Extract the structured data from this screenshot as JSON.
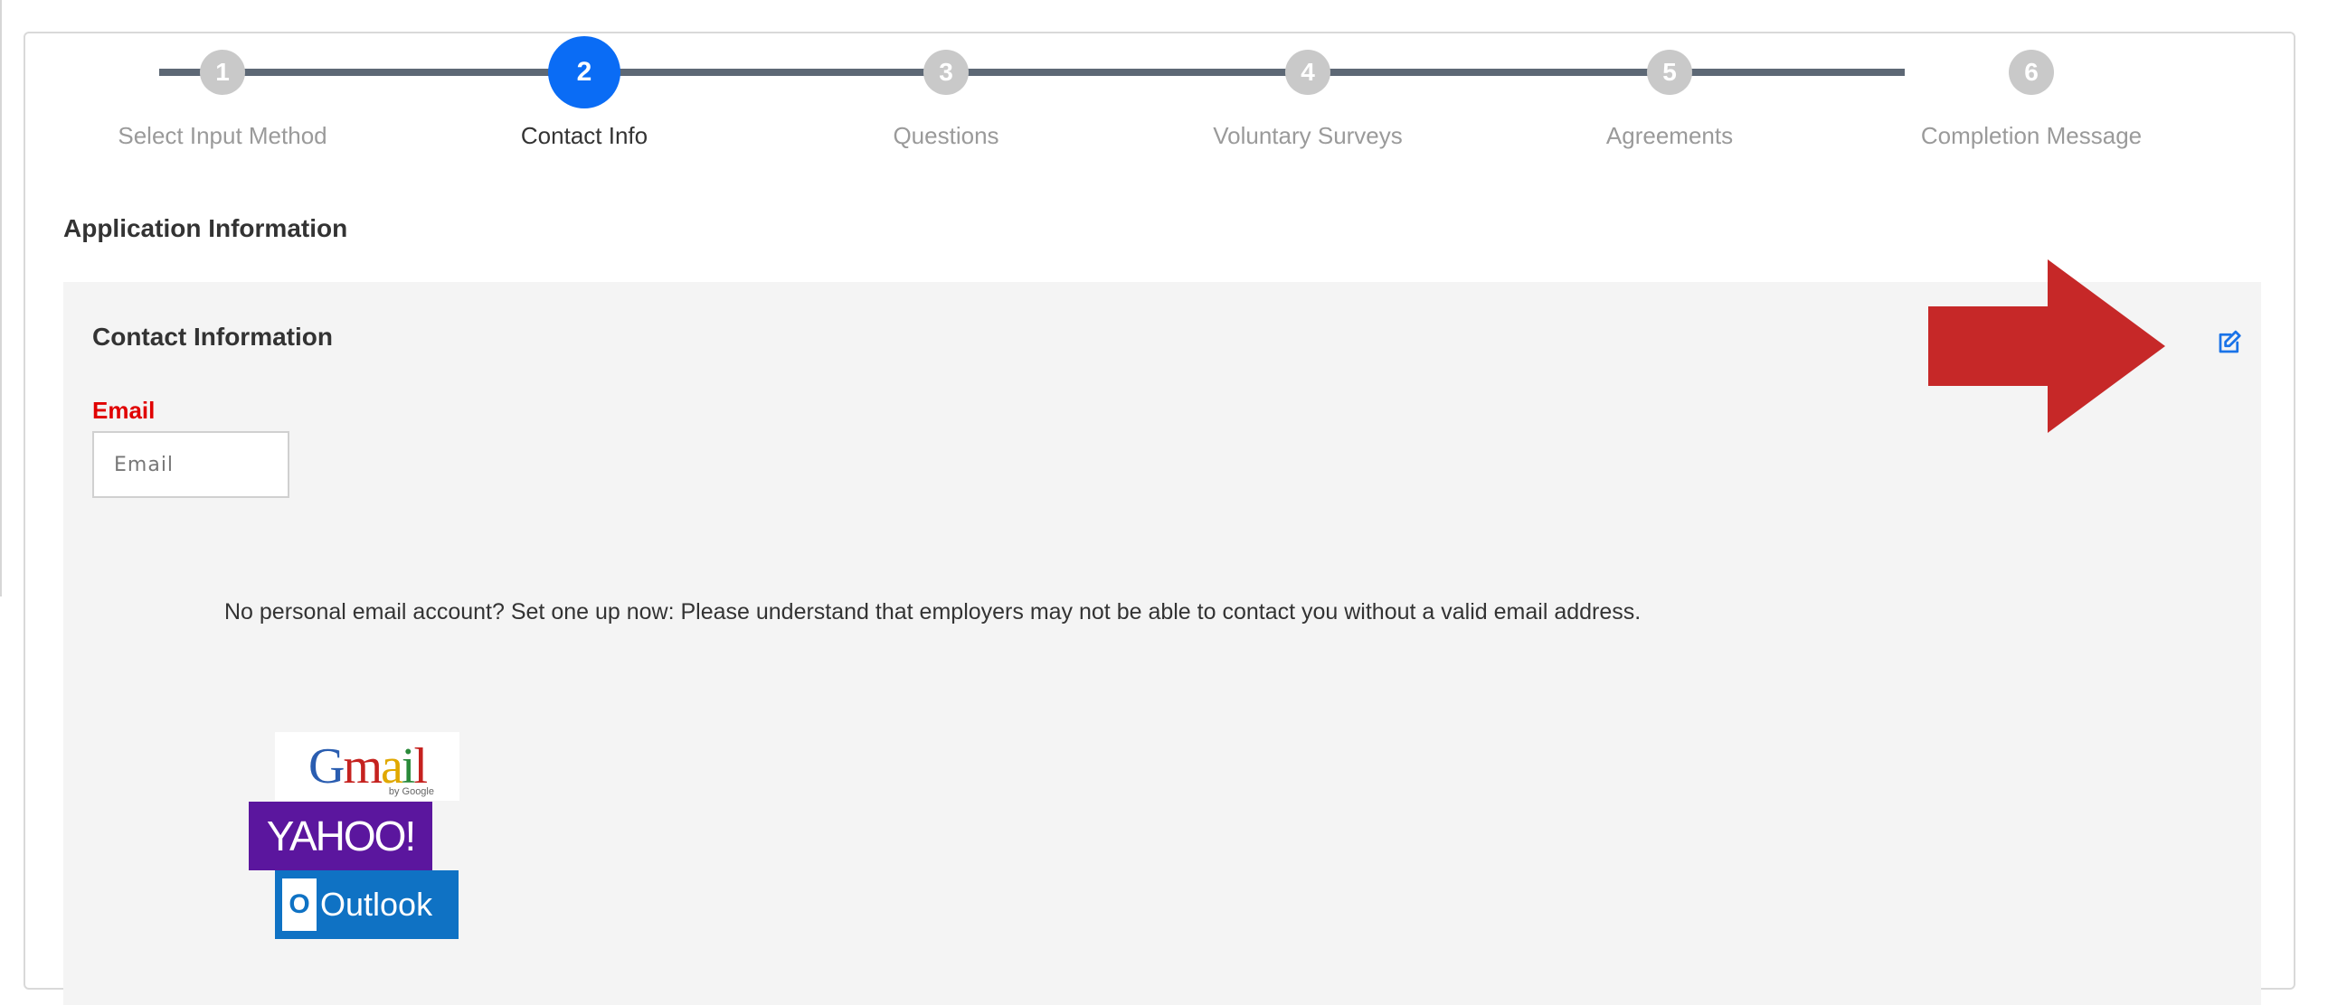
{
  "stepper": {
    "steps": [
      {
        "number": "1",
        "label": "Select Input Method",
        "active": false
      },
      {
        "number": "2",
        "label": "Contact Info",
        "active": true
      },
      {
        "number": "3",
        "label": "Questions",
        "active": false
      },
      {
        "number": "4",
        "label": "Voluntary Surveys",
        "active": false
      },
      {
        "number": "5",
        "label": "Agreements",
        "active": false
      },
      {
        "number": "6",
        "label": "Completion Message",
        "active": false
      }
    ]
  },
  "application": {
    "title": "Application Information"
  },
  "contact": {
    "title": "Contact Information",
    "email_label": "Email",
    "email_placeholder": "Email",
    "email_value": "",
    "no_email_text": "No personal email account? Set one up now: Please understand that employers may not be able to contact you without a valid email address."
  },
  "providers": {
    "gmail": {
      "text": "Gmail",
      "sub": "by Google"
    },
    "yahoo": {
      "text": "YAHOO!"
    },
    "outlook": {
      "text": "Outlook",
      "badge": "O"
    }
  },
  "colors": {
    "active_step": "#0a6cf5",
    "inactive_step": "#c9c9c9",
    "connector": "#5d6875",
    "required_label": "#e00000",
    "annotation_arrow": "#c62828",
    "edit_icon": "#1a73e8"
  },
  "icons": {
    "edit": "edit-icon",
    "annotation": "red-arrow-icon"
  }
}
